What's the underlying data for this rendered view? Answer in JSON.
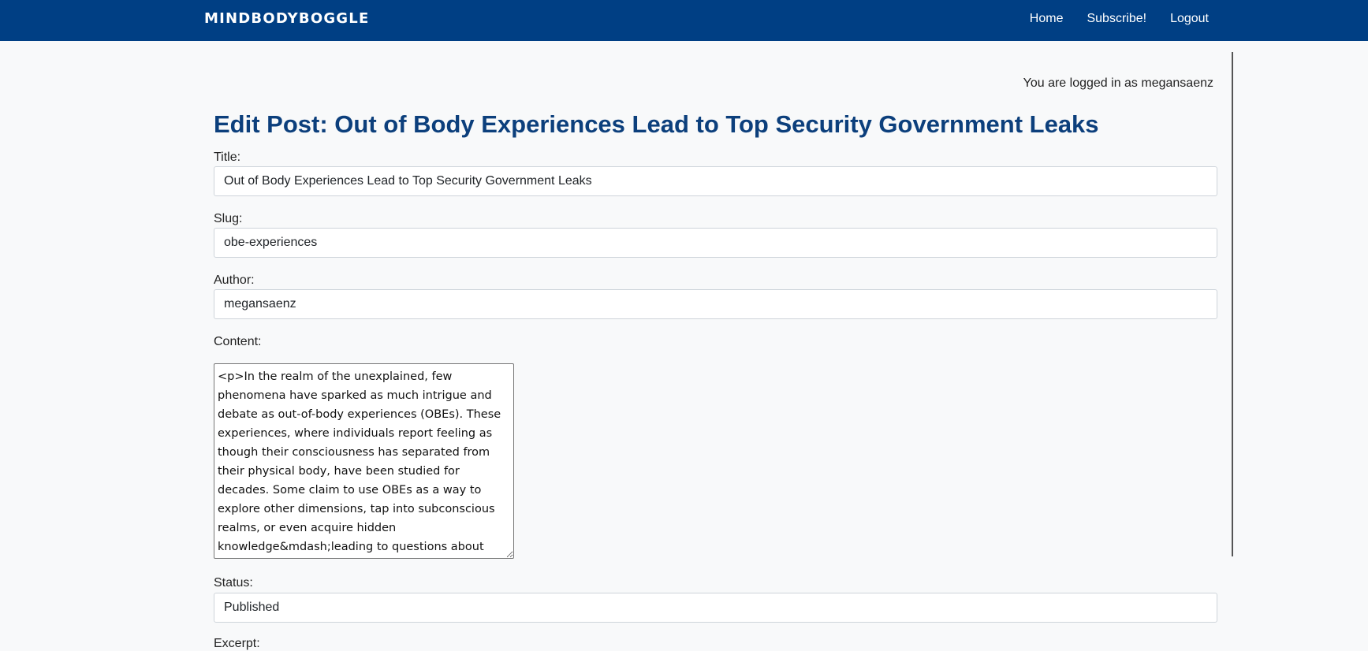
{
  "nav": {
    "brand": "MINDBODYBOGGLE",
    "links": [
      {
        "label": "Home"
      },
      {
        "label": "Subscribe!"
      },
      {
        "label": "Logout"
      }
    ]
  },
  "login_status": "You are logged in as megansaenz",
  "page_title": "Edit Post: Out of Body Experiences Lead to Top Security Government Leaks",
  "form": {
    "title_label": "Title:",
    "title_value": "Out of Body Experiences Lead to Top Security Government Leaks",
    "slug_label": "Slug:",
    "slug_value": "obe-experiences",
    "author_label": "Author:",
    "author_value": "megansaenz",
    "content_label": "Content:",
    "content_value": "<p>In the realm of the unexplained, few phenomena have sparked as much intrigue and debate as out-of-body experiences (OBEs). These experiences, where individuals report feeling as though their consciousness has separated from their physical body, have been studied for decades. Some claim to use OBEs as a way to explore other dimensions, tap into subconscious realms, or even acquire hidden knowledge&mdash;leading to questions about whether OBEs could be used to access confidential",
    "status_label": "Status:",
    "status_value": "Published",
    "excerpt_label": "Excerpt:"
  }
}
